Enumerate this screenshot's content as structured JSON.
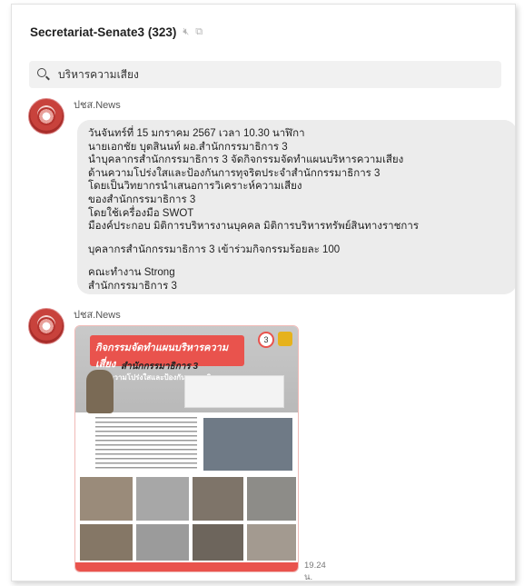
{
  "chat": {
    "title": "Secretariat-Senate3 (323)"
  },
  "search": {
    "value": "บริหารความเสียง"
  },
  "messages": [
    {
      "sender": "ปชส.News",
      "lines": [
        " วันจันทร์ที่ 15 มกราคม 2567 เวลา 10.30 นาฬิกา",
        "นายเอกชัย บุตสินนท์  ผอ.สำนักกรรมาธิการ 3",
        "นำบุคลากรสำนักกรรมาธิการ 3 จัดกิจกรรมจัดทำแผนบริหารความเสียง",
        "ด้านความโปร่งใสและป้องกันการทุจริตประจำสำนักกรรมาธิการ 3",
        "โดยเป็นวิทยากรนำเสนอการวิเคราะห์ความเสียง",
        "ของสำนักกรรมาธิการ 3",
        "โดยใช้เครื่องมือ SWOT",
        "มืองค์ประกอบ มิติการบริหารงานบุคคล มิติการบริหารทรัพย์สินทางราชการ",
        "",
        " บุคลากรสำนักกรรมาธิการ 3 เข้าร่วมกิจกรรมร้อยละ 100",
        "",
        "คณะทำงาน Strong",
        "สำนักกรรมาธิการ 3"
      ]
    },
    {
      "sender": "ปชส.News",
      "image": {
        "banner_line1": "กิจกรรมจัดทำแผนบริหารความเสี่ยง",
        "banner_line2": "ด้านความโปร่งใสและป้องกันการทุจริต",
        "subtitle": "สำนักกรรมาธิการ 3",
        "badge": "3"
      },
      "time": "19.24 น."
    }
  ]
}
